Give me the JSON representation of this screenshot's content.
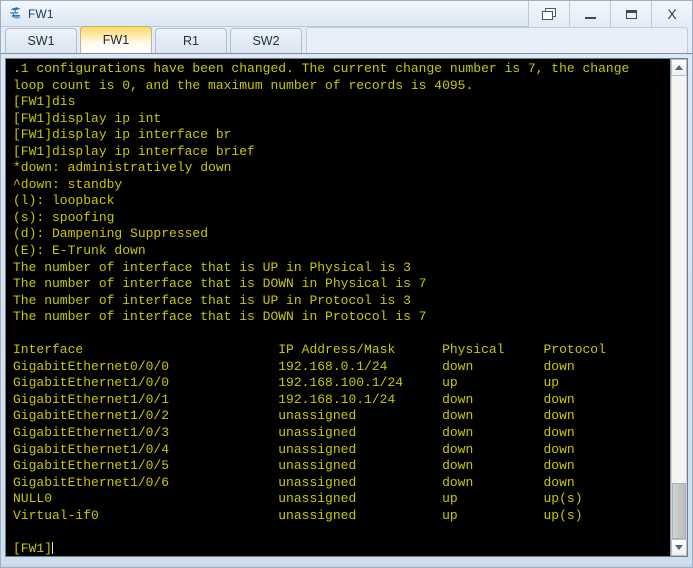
{
  "window": {
    "title": "FW1",
    "icon": "network-device-icon",
    "controls": {
      "restore": "❐",
      "minimize": "_",
      "maximize": "□",
      "close": "X"
    }
  },
  "tabs": [
    {
      "label": "SW1",
      "active": false
    },
    {
      "label": "FW1",
      "active": true
    },
    {
      "label": "R1",
      "active": false
    },
    {
      "label": "SW2",
      "active": false
    }
  ],
  "terminal": {
    "prompt": "[FW1]",
    "colors": {
      "background": "#000000",
      "text": "#c8c800"
    },
    "lines": [
      ".1 configurations have been changed. The current change number is 7, the change",
      "loop count is 0, and the maximum number of records is 4095.",
      "[FW1]dis",
      "[FW1]display ip int",
      "[FW1]display ip interface br",
      "[FW1]display ip interface brief",
      "*down: administratively down",
      "^down: standby",
      "(l): loopback",
      "(s): spoofing",
      "(d): Dampening Suppressed",
      "(E): E-Trunk down",
      "The number of interface that is UP in Physical is 3",
      "The number of interface that is DOWN in Physical is 7",
      "The number of interface that is UP in Protocol is 3",
      "The number of interface that is DOWN in Protocol is 7",
      "",
      "Interface                         IP Address/Mask      Physical     Protocol",
      "GigabitEthernet0/0/0              192.168.0.1/24       down         down",
      "GigabitEthernet1/0/0              192.168.100.1/24     up           up",
      "GigabitEthernet1/0/1              192.168.10.1/24      down         down",
      "GigabitEthernet1/0/2              unassigned           down         down",
      "GigabitEthernet1/0/3              unassigned           down         down",
      "GigabitEthernet1/0/4              unassigned           down         down",
      "GigabitEthernet1/0/5              unassigned           down         down",
      "GigabitEthernet1/0/6              unassigned           down         down",
      "NULL0                             unassigned           up           up(s)",
      "Virtual-if0                       unassigned           up           up(s)",
      "",
      "[FW1]"
    ],
    "interface_table": {
      "headers": [
        "Interface",
        "IP Address/Mask",
        "Physical",
        "Protocol"
      ],
      "rows": [
        [
          "GigabitEthernet0/0/0",
          "192.168.0.1/24",
          "down",
          "down"
        ],
        [
          "GigabitEthernet1/0/0",
          "192.168.100.1/24",
          "up",
          "up"
        ],
        [
          "GigabitEthernet1/0/1",
          "192.168.10.1/24",
          "down",
          "down"
        ],
        [
          "GigabitEthernet1/0/2",
          "unassigned",
          "down",
          "down"
        ],
        [
          "GigabitEthernet1/0/3",
          "unassigned",
          "down",
          "down"
        ],
        [
          "GigabitEthernet1/0/4",
          "unassigned",
          "down",
          "down"
        ],
        [
          "GigabitEthernet1/0/5",
          "unassigned",
          "down",
          "down"
        ],
        [
          "GigabitEthernet1/0/6",
          "unassigned",
          "down",
          "down"
        ],
        [
          "NULL0",
          "unassigned",
          "up",
          "up(s)"
        ],
        [
          "Virtual-if0",
          "unassigned",
          "up",
          "up(s)"
        ]
      ]
    },
    "stats": {
      "up_physical": "3",
      "down_physical": "7",
      "up_protocol": "3",
      "down_protocol": "7",
      "change_number": "7",
      "change_loop_count": "0",
      "max_records": "4095"
    }
  },
  "scrollbar": {
    "up_arrow": "∧",
    "down_arrow": "∨",
    "thumb_top_pct": 88,
    "thumb_height_pct": 12
  }
}
